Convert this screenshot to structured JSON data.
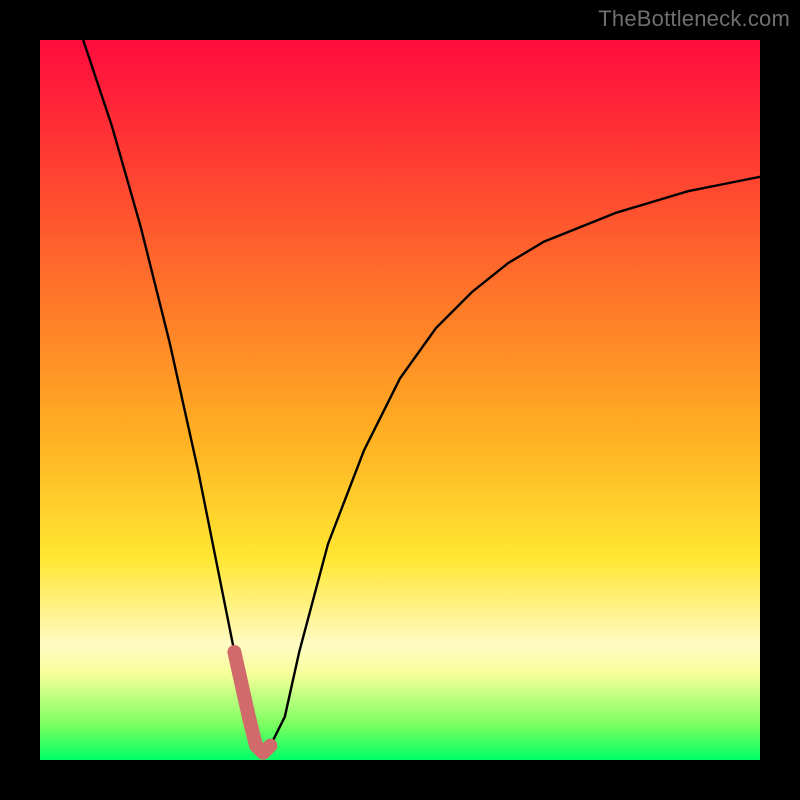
{
  "watermark": {
    "text": "TheBottleneck.com"
  },
  "chart_data": {
    "type": "line",
    "title": "",
    "xlabel": "",
    "ylabel": "",
    "xlim": [
      0,
      100
    ],
    "ylim": [
      0,
      100
    ],
    "grid": false,
    "series": [
      {
        "name": "bottleneck-curve",
        "x": [
          6,
          10,
          14,
          18,
          22,
          25,
          27,
          29,
          30,
          31,
          32,
          34,
          36,
          40,
          45,
          50,
          55,
          60,
          65,
          70,
          75,
          80,
          85,
          90,
          95,
          100
        ],
        "values": [
          100,
          88,
          74,
          58,
          40,
          25,
          15,
          6,
          2,
          1,
          2,
          6,
          15,
          30,
          43,
          53,
          60,
          65,
          69,
          72,
          74,
          76,
          77.5,
          79,
          80,
          81
        ]
      }
    ],
    "annotations": [
      {
        "name": "min-region-highlight",
        "color": "#d16a6a",
        "x_from": 26.5,
        "x_to": 33.5
      }
    ],
    "colors": {
      "curve": "#000000",
      "highlight": "#d16a6a",
      "frame": "#000000",
      "gradient_top": "#ff0b3e",
      "gradient_bottom": "#00ff66"
    }
  }
}
